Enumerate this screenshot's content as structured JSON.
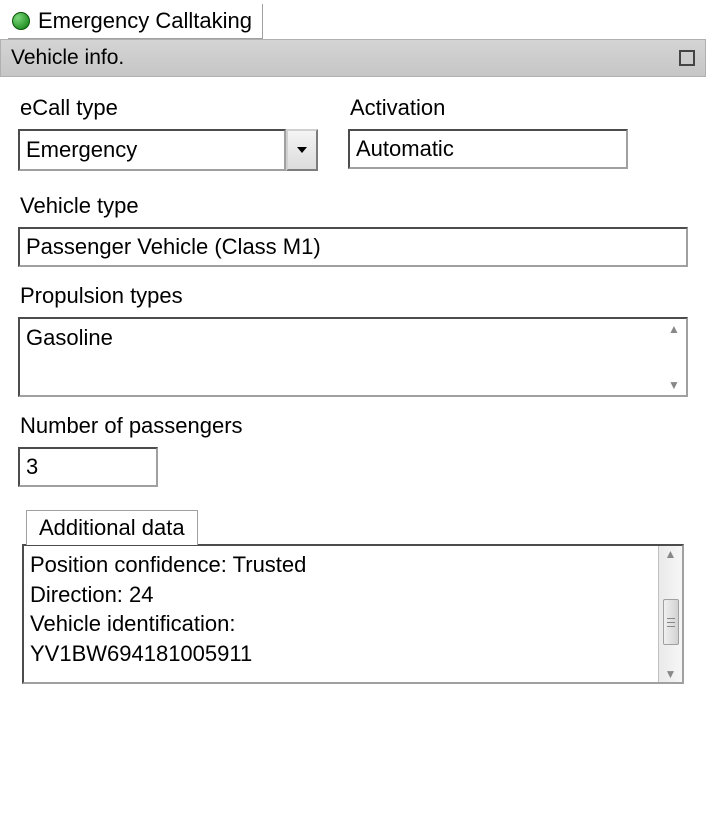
{
  "main_tab": {
    "label": "Emergency Calltaking"
  },
  "panel": {
    "title": "Vehicle info.",
    "ecall_type": {
      "label": "eCall type",
      "value": "Emergency"
    },
    "activation": {
      "label": "Activation",
      "value": "Automatic"
    },
    "vehicle_type": {
      "label": "Vehicle type",
      "value": "Passenger Vehicle (Class M1)"
    },
    "propulsion": {
      "label": "Propulsion types",
      "value": "Gasoline"
    },
    "passengers": {
      "label": "Number of passengers",
      "value": "3"
    },
    "additional": {
      "tab_label": "Additional data",
      "text": "Position confidence: Trusted\nDirection: 24\nVehicle identification:\nYV1BW694181005911"
    }
  }
}
